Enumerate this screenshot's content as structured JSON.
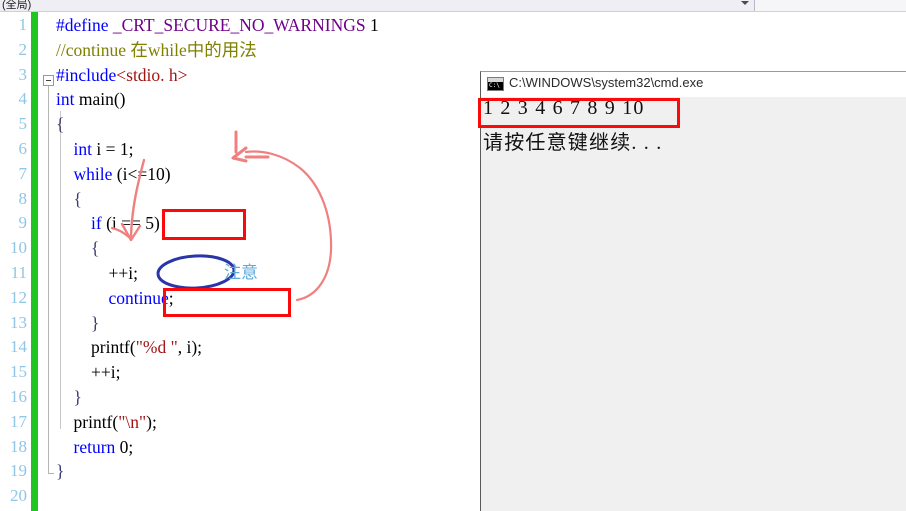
{
  "navbar": {
    "scope_label": "(全局)",
    "dropdown_icon": "chevron-down-icon"
  },
  "editor": {
    "line_numbers": [
      "1",
      "2",
      "3",
      "4",
      "5",
      "6",
      "7",
      "8",
      "9",
      "10",
      "11",
      "12",
      "13",
      "14",
      "15",
      "16",
      "17",
      "18",
      "19",
      "20"
    ],
    "lines": [
      {
        "n": 1,
        "segments": [
          {
            "t": "#define",
            "c": "pp"
          },
          {
            "t": " ",
            "c": "plain"
          },
          {
            "t": "_CRT_SECURE_NO_WARNINGS",
            "c": "macro"
          },
          {
            "t": " 1",
            "c": "plain"
          }
        ]
      },
      {
        "n": 2,
        "segments": [
          {
            "t": "//continue 在while中的用法",
            "c": "cmt"
          }
        ]
      },
      {
        "n": 3,
        "segments": [
          {
            "t": "#include",
            "c": "pp"
          },
          {
            "t": "<stdio. h>",
            "c": "hdr"
          }
        ]
      },
      {
        "n": 4,
        "segments": [
          {
            "t": "int",
            "c": "kw"
          },
          {
            "t": " main()",
            "c": "plain"
          }
        ]
      },
      {
        "n": 5,
        "segments": [
          {
            "t": "{",
            "c": "brace"
          }
        ]
      },
      {
        "n": 6,
        "segments": [
          {
            "t": "    ",
            "c": "plain"
          },
          {
            "t": "int",
            "c": "kw"
          },
          {
            "t": " i = 1;",
            "c": "plain"
          }
        ]
      },
      {
        "n": 7,
        "segments": [
          {
            "t": "    ",
            "c": "plain"
          },
          {
            "t": "while",
            "c": "kw"
          },
          {
            "t": " (i<=10)",
            "c": "plain"
          }
        ]
      },
      {
        "n": 8,
        "segments": [
          {
            "t": "    {",
            "c": "brace"
          }
        ]
      },
      {
        "n": 9,
        "segments": [
          {
            "t": "        ",
            "c": "plain"
          },
          {
            "t": "if",
            "c": "kw"
          },
          {
            "t": " (i == 5)",
            "c": "plain"
          }
        ]
      },
      {
        "n": 10,
        "segments": [
          {
            "t": "        {",
            "c": "brace"
          }
        ]
      },
      {
        "n": 11,
        "segments": [
          {
            "t": "            ++i;",
            "c": "plain"
          }
        ]
      },
      {
        "n": 12,
        "segments": [
          {
            "t": "            ",
            "c": "plain"
          },
          {
            "t": "continue",
            "c": "kw"
          },
          {
            "t": ";",
            "c": "plain"
          }
        ]
      },
      {
        "n": 13,
        "segments": [
          {
            "t": "        }",
            "c": "brace"
          }
        ]
      },
      {
        "n": 14,
        "segments": [
          {
            "t": "        printf(",
            "c": "plain"
          },
          {
            "t": "\"%d \"",
            "c": "str"
          },
          {
            "t": ", i);",
            "c": "plain"
          }
        ]
      },
      {
        "n": 15,
        "segments": [
          {
            "t": "        ++i;",
            "c": "plain"
          }
        ]
      },
      {
        "n": 16,
        "segments": [
          {
            "t": "    }",
            "c": "brace"
          }
        ]
      },
      {
        "n": 17,
        "segments": [
          {
            "t": "    printf(",
            "c": "plain"
          },
          {
            "t": "\"\\n\"",
            "c": "str"
          },
          {
            "t": ");",
            "c": "plain"
          }
        ]
      },
      {
        "n": 18,
        "segments": [
          {
            "t": "    ",
            "c": "plain"
          },
          {
            "t": "return",
            "c": "kw"
          },
          {
            "t": " 0;",
            "c": "plain"
          }
        ]
      },
      {
        "n": 19,
        "segments": [
          {
            "t": "}",
            "c": "brace"
          }
        ]
      },
      {
        "n": 20,
        "segments": []
      }
    ]
  },
  "annotations": {
    "note_label": "注意",
    "highlight_condition": "(i == 5)",
    "highlight_continue": "continue;",
    "ellipse_target": "++i;",
    "colors": {
      "box_red": "#fa0a0a",
      "arrow_pink": "#f08080",
      "ellipse_blue": "#2a35a8",
      "note_blue": "#5fa8dc",
      "change_bar_green": "#21c521",
      "line_number_blue": "#8fc6e8"
    }
  },
  "console": {
    "icon": "cmd-window-icon",
    "title": "C:\\WINDOWS\\system32\\cmd.exe",
    "output_lines": [
      "1 2 3 4 6 7 8 9 10",
      "请按任意键继续. . ."
    ],
    "highlighted_output": "1 2 3 4 6 7 8 9 10"
  }
}
